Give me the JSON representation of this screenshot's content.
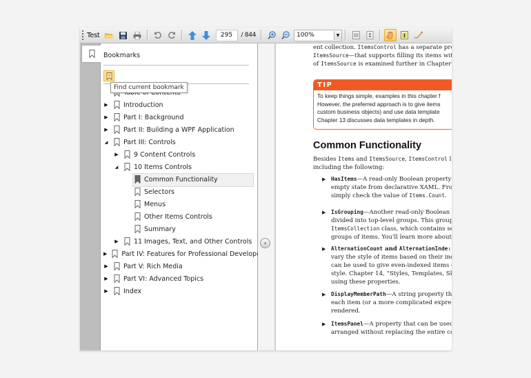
{
  "toolbar": {
    "title": "Test",
    "current_page": "295",
    "total_pages": "/ 844",
    "zoom_level": "100%",
    "icons": [
      "open-folder-icon",
      "save-icon",
      "print-icon",
      "undo-icon",
      "redo-icon",
      "previous-page-icon",
      "next-page-icon",
      "zoom-in-icon",
      "zoom-out-icon",
      "fit-width-icon",
      "fit-page-icon",
      "pan-tool-icon",
      "text-select-icon",
      "ink-annotation-icon"
    ]
  },
  "sidebar": {
    "tab_icon": "bookmark-icon",
    "title": "Bookmarks",
    "find_button_tooltip": "Find current bookmark",
    "items": [
      {
        "label": "Table of Contents",
        "level": 0,
        "expander": "none"
      },
      {
        "label": "Introduction",
        "level": 0,
        "expander": "collapsed"
      },
      {
        "label": "Part I: Background",
        "level": 0,
        "expander": "collapsed"
      },
      {
        "label": "Part II: Building a WPF Application",
        "level": 0,
        "expander": "collapsed"
      },
      {
        "label": "Part III: Controls",
        "level": 0,
        "expander": "expanded"
      },
      {
        "label": "9 Content Controls",
        "level": 1,
        "expander": "collapsed"
      },
      {
        "label": "10 Items Controls",
        "level": 1,
        "expander": "expanded"
      },
      {
        "label": "Common Functionality",
        "level": 2,
        "expander": "none",
        "selected": true
      },
      {
        "label": "Selectors",
        "level": 2,
        "expander": "none"
      },
      {
        "label": "Menus",
        "level": 2,
        "expander": "none"
      },
      {
        "label": "Other Items Controls",
        "level": 2,
        "expander": "none"
      },
      {
        "label": "Summary",
        "level": 2,
        "expander": "none"
      },
      {
        "label": "11 Images, Text, and Other Controls",
        "level": 1,
        "expander": "collapsed"
      },
      {
        "label": "Part IV: Features for Professional Developers",
        "level": 0,
        "expander": "collapsed"
      },
      {
        "label": "Part V: Rich Media",
        "level": 0,
        "expander": "collapsed"
      },
      {
        "label": "Part VI: Advanced Topics",
        "level": 0,
        "expander": "collapsed"
      },
      {
        "label": "Index",
        "level": 0,
        "expander": "collapsed"
      }
    ]
  },
  "document": {
    "intro_lines": [
      [
        {
          "t": "ent collection. "
        },
        {
          "t": "ItemsControl",
          "m": 1
        },
        {
          "t": " has a separate prop"
        }
      ],
      [
        {
          "t": "ItemsSource",
          "m": 1
        },
        {
          "t": "—that supports filling its items wit"
        }
      ],
      [
        {
          "t": "of "
        },
        {
          "t": "ItemsSource",
          "m": 1
        },
        {
          "t": " is examined further in Chapter"
        }
      ]
    ],
    "tip": {
      "heading": "TIP",
      "lines": [
        "To keep things simple, examples in this chapter f",
        "However, the preferred approach is to give items",
        "custom business objects) and use data template",
        "Chapter 13 discusses data templates in depth."
      ]
    },
    "section_heading": "Common Functionality",
    "section_intro": [
      [
        {
          "t": "Besides "
        },
        {
          "t": "Items",
          "m": 1
        },
        {
          "t": " and "
        },
        {
          "t": "ItemsSource",
          "m": 1
        },
        {
          "t": ", "
        },
        {
          "t": "ItemsControl",
          "m": 1
        },
        {
          "t": " l"
        }
      ],
      [
        {
          "t": "including the following:"
        }
      ]
    ],
    "bullets": [
      {
        "lines": [
          [
            {
              "t": "HasItems",
              "b": 1
            },
            {
              "t": "—A read-only Boolean property"
            }
          ],
          [
            {
              "t": "empty state from declarative XAML. From"
            }
          ],
          [
            {
              "t": "simply check the value of "
            },
            {
              "t": "Items.Count",
              "m": 1
            },
            {
              "t": "."
            }
          ]
        ]
      },
      {
        "lines": [
          [
            {
              "t": "IsGrouping",
              "b": 1
            },
            {
              "t": "—Another read-only Boolean p"
            }
          ],
          [
            {
              "t": "divided into top-level groups. This groupi"
            }
          ],
          [
            {
              "t": "ItemsCollection",
              "m": 1
            },
            {
              "t": " class, which contains se"
            }
          ],
          [
            {
              "t": "groups of items. You'll learn more about g"
            }
          ]
        ]
      },
      {
        "lines": [
          [
            {
              "t": "AlternationCount",
              "b": 1
            },
            {
              "t": " and ",
              "bs": 1
            },
            {
              "t": "AlternationInde:",
              "b": 1
            }
          ],
          [
            {
              "t": "vary the style of items based on their inde"
            }
          ],
          [
            {
              "t": "can be used to give even-indexed items or"
            }
          ],
          [
            {
              "t": "style. Chapter 14, “Styles, Templates, Skin"
            }
          ],
          [
            {
              "t": "using these properties."
            }
          ]
        ]
      },
      {
        "lines": [
          [
            {
              "t": "DisplayMemberPath",
              "b": 1
            },
            {
              "t": "—A string property tha"
            }
          ],
          [
            {
              "t": "each item (or a more complicated express"
            }
          ],
          [
            {
              "t": "rendered."
            }
          ]
        ]
      },
      {
        "lines": [
          [
            {
              "t": "ItemsPanel",
              "b": 1
            },
            {
              "t": "—A property that can be used"
            }
          ],
          [
            {
              "t": "arranged without replacing the entire con"
            }
          ]
        ]
      }
    ]
  },
  "colors": {
    "tip_accent": "#f15a24",
    "active_tool": "#f8c65c",
    "selected_row": "#f0f0f0"
  }
}
